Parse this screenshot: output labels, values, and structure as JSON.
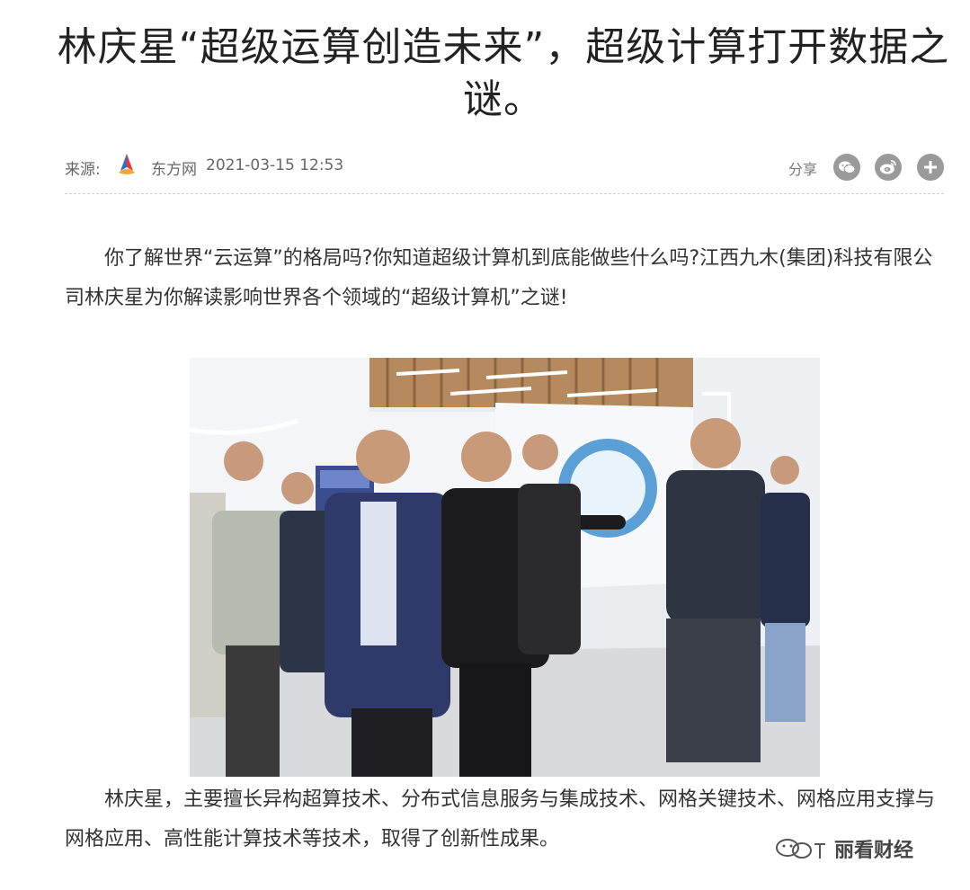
{
  "article": {
    "title": "林庆星“超级运算创造未来”，超级计算打开数据之谜。",
    "meta": {
      "source_label": "来源:",
      "source_name": "东方网",
      "date": "2021-03-15 12:53",
      "share_label": "分享",
      "share_icons": [
        "wechat-icon",
        "weibo-icon",
        "plus-icon"
      ]
    },
    "paragraphs": [
      "你了解世界“云运算”的格局吗?你知道超级计算机到底能做些什么吗?江西九木(集团)科技有限公司林庆星为你解读影响世界各个领域的“超级计算机”之谜!",
      "林庆星，主要擅长异构超算技术、分布式信息服务与集成技术、网格关键技术、网格应用支撑与网格应用、高性能计算技术等技术，取得了创新性成果。"
    ]
  },
  "watermark": {
    "text": "丽看财经"
  },
  "colors": {
    "title": "#222222",
    "body_text": "#333333",
    "meta_text": "#666666",
    "share_icon_bg": "#9a9a9a"
  }
}
